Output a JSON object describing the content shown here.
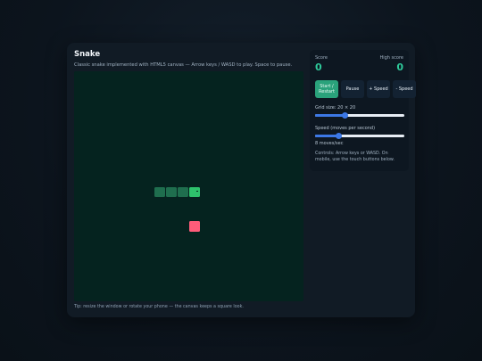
{
  "app": {
    "title": "Snake",
    "subtitle": "Classic snake implemented with HTML5 canvas — Arrow keys / WASD to play. Space to pause.",
    "tip": "Tip: resize the window or rotate your phone — the canvas keeps a square look."
  },
  "scoreboard": {
    "score_label": "Score",
    "score_value": "0",
    "high_label": "High score",
    "high_value": "0"
  },
  "controls": {
    "start_label": "Start / Restart",
    "pause_label": "Pause",
    "speed_up_label": "+ Speed",
    "speed_down_label": "- Speed"
  },
  "grid_slider": {
    "label": "Grid size: 20 × 20",
    "value": 20,
    "min": 10,
    "max": 40
  },
  "speed_slider": {
    "label": "Speed (moves per second)",
    "value": 8,
    "min": 2,
    "max": 25,
    "readout": "8 moves/sec"
  },
  "note": "Controls: Arrow keys or WASD. On mobile, use the touch buttons below.",
  "game": {
    "grid": 20,
    "snake": [
      [
        7,
        10
      ],
      [
        8,
        10
      ],
      [
        9,
        10
      ],
      [
        10,
        10
      ]
    ],
    "food": [
      10,
      13
    ],
    "direction": "right"
  },
  "colors": {
    "accent": "#2ec99a",
    "snake_head": "#2ec26c",
    "snake_body": "#1f6e4e",
    "food": "#ff5c7a",
    "board": "#05231f",
    "slider": "#3c78e6"
  }
}
